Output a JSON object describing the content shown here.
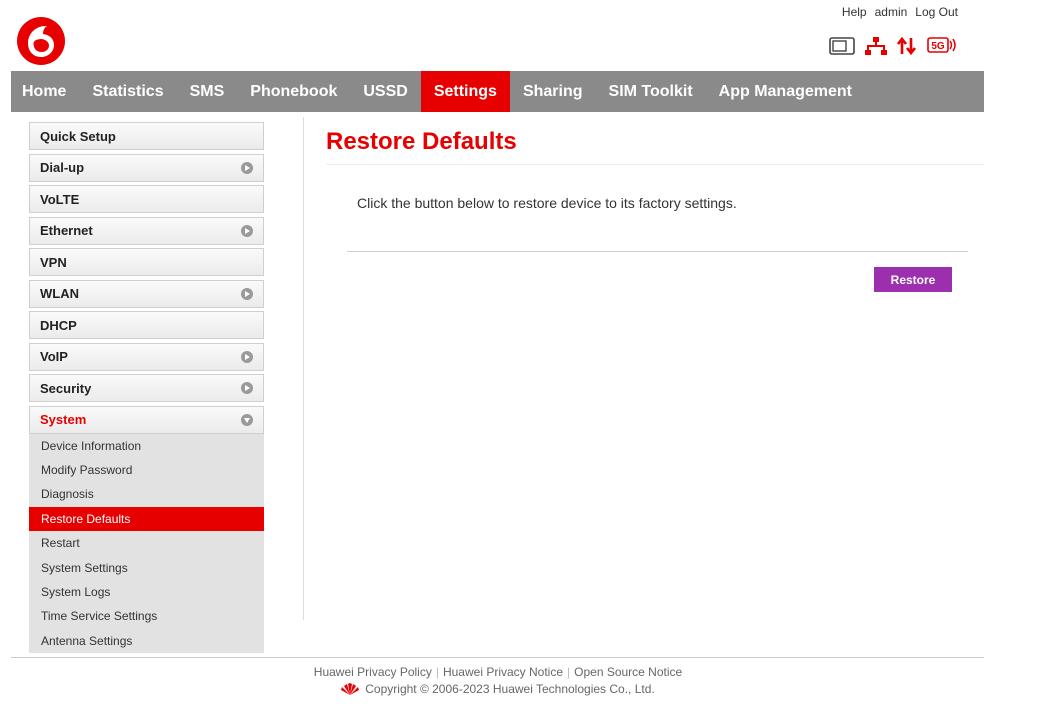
{
  "header": {
    "links": {
      "help": "Help",
      "user": "admin",
      "logout": "Log Out"
    },
    "status_icons": [
      "window-icon",
      "network-icon",
      "data-arrows-icon",
      "5g-signal-icon"
    ],
    "fiveg_label": "5G"
  },
  "colors": {
    "brand_red": "#e60000",
    "nav_gray": "#8a8a8a",
    "button_purple": "#9b2fae"
  },
  "nav": {
    "items": [
      {
        "label": "Home"
      },
      {
        "label": "Statistics"
      },
      {
        "label": "SMS"
      },
      {
        "label": "Phonebook"
      },
      {
        "label": "USSD"
      },
      {
        "label": "Settings",
        "active": true
      },
      {
        "label": "Sharing"
      },
      {
        "label": "SIM Toolkit"
      },
      {
        "label": "App Management"
      }
    ]
  },
  "sidebar": {
    "items": [
      {
        "label": "Quick Setup"
      },
      {
        "label": "Dial-up"
      },
      {
        "label": "VoLTE"
      },
      {
        "label": "Ethernet"
      },
      {
        "label": "VPN"
      },
      {
        "label": "WLAN"
      },
      {
        "label": "DHCP"
      },
      {
        "label": "VoIP"
      },
      {
        "label": "Security"
      },
      {
        "label": "System",
        "expanded": true
      }
    ],
    "system_sub": [
      {
        "label": "Device Information"
      },
      {
        "label": "Modify Password"
      },
      {
        "label": "Diagnosis"
      },
      {
        "label": "Restore Defaults",
        "active": true
      },
      {
        "label": "Restart"
      },
      {
        "label": "System Settings"
      },
      {
        "label": "System Logs"
      },
      {
        "label": "Time Service Settings"
      },
      {
        "label": "Antenna Settings"
      }
    ]
  },
  "main": {
    "title": "Restore Defaults",
    "description": "Click the button below to restore device to its factory settings.",
    "restore_label": "Restore"
  },
  "footer": {
    "links": [
      "Huawei Privacy Policy",
      "Huawei Privacy Notice",
      "Open Source Notice"
    ],
    "copyright": "Copyright © 2006-2023 Huawei Technologies Co., Ltd."
  }
}
